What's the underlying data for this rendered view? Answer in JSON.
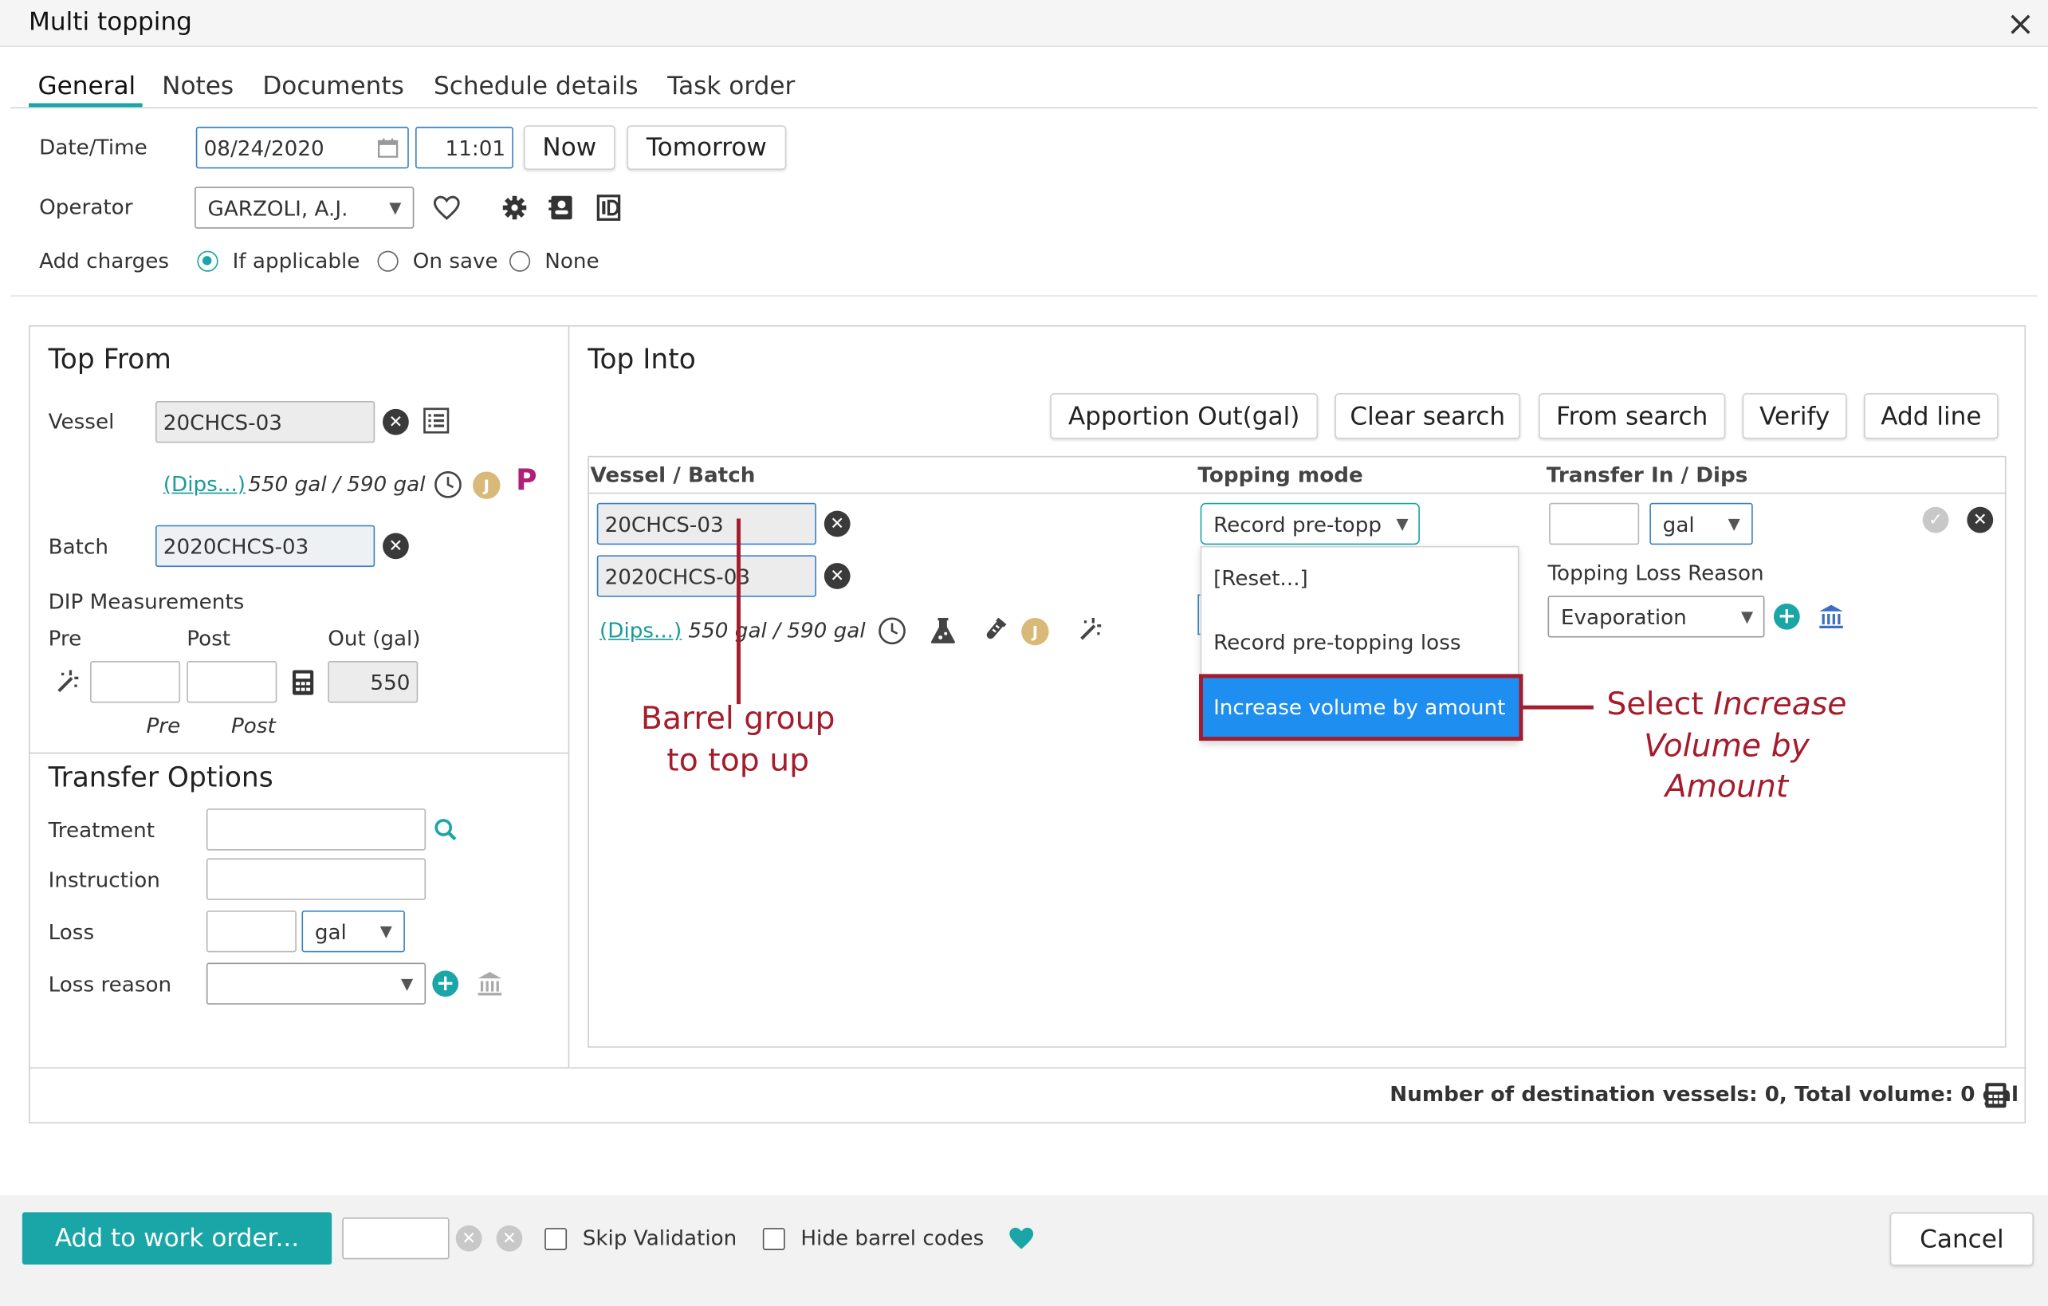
{
  "window": {
    "title": "Multi topping",
    "close_glyph": "×"
  },
  "tabs": [
    "General",
    "Notes",
    "Documents",
    "Schedule details",
    "Task order"
  ],
  "general": {
    "datetime_label": "Date/Time",
    "date_value": "08/24/2020",
    "time_value": "11:01",
    "now_label": "Now",
    "tomorrow_label": "Tomorrow",
    "operator_label": "Operator",
    "operator_value": "GARZOLI, A.J.",
    "charges_label": "Add charges",
    "charges_options": [
      "If applicable",
      "On save",
      "None"
    ],
    "charges_selected": "If applicable"
  },
  "top_from": {
    "title": "Top From",
    "vessel_label": "Vessel",
    "vessel_value": "20CHCS-03",
    "dips_link": "(Dips...)",
    "dips_volume": "550 gal / 590 gal",
    "batch_label": "Batch",
    "batch_value": "2020CHCS-03",
    "dip_title": "DIP Measurements",
    "pre_label": "Pre",
    "post_label": "Post",
    "out_label": "Out (gal)",
    "out_value": "550",
    "pre_sub": "Pre",
    "post_sub": "Post",
    "p_badge": "P",
    "j_badge": "J"
  },
  "transfer_options": {
    "title": "Transfer Options",
    "treatment_label": "Treatment",
    "instruction_label": "Instruction",
    "loss_label": "Loss",
    "loss_unit": "gal",
    "loss_reason_label": "Loss reason"
  },
  "top_into": {
    "title": "Top Into",
    "buttons": [
      "Apportion Out(gal)",
      "Clear search",
      "From search",
      "Verify",
      "Add line"
    ],
    "columns": [
      "Vessel / Batch",
      "Topping mode",
      "Transfer In / Dips"
    ],
    "row": {
      "vessel": "20CHCS-03",
      "batch": "2020CHCS-03",
      "dips_link": "(Dips...)",
      "dips_volume": "550 gal / 590 gal",
      "j_badge": "J",
      "topping_mode": "Record pre-topp",
      "unit": "gal",
      "loss_reason_label": "Topping Loss Reason",
      "loss_reason_value": "Evaporation"
    },
    "dropdown_options": [
      "[Reset...]",
      "Record pre-topping loss",
      "Increase volume by amount"
    ],
    "dropdown_highlighted": "Increase volume by amount",
    "summary": "Number of destination vessels: 0, Total volume: 0 gal"
  },
  "annotations": {
    "barrel_line1": "Barrel group",
    "barrel_line2": "to top up",
    "select_prefix": "Select ",
    "select_italic1": "Increase",
    "select_line2": "Volume by",
    "select_line3": "Amount"
  },
  "footer": {
    "add_button": "Add to work order...",
    "skip_validation": "Skip Validation",
    "hide_barrel_codes": "Hide barrel codes",
    "cancel": "Cancel"
  },
  "colors": {
    "teal": "#1aa6a6",
    "annotation_red": "#a51c2c",
    "highlight_blue": "#1e8ef0",
    "magenta": "#b0207a"
  }
}
